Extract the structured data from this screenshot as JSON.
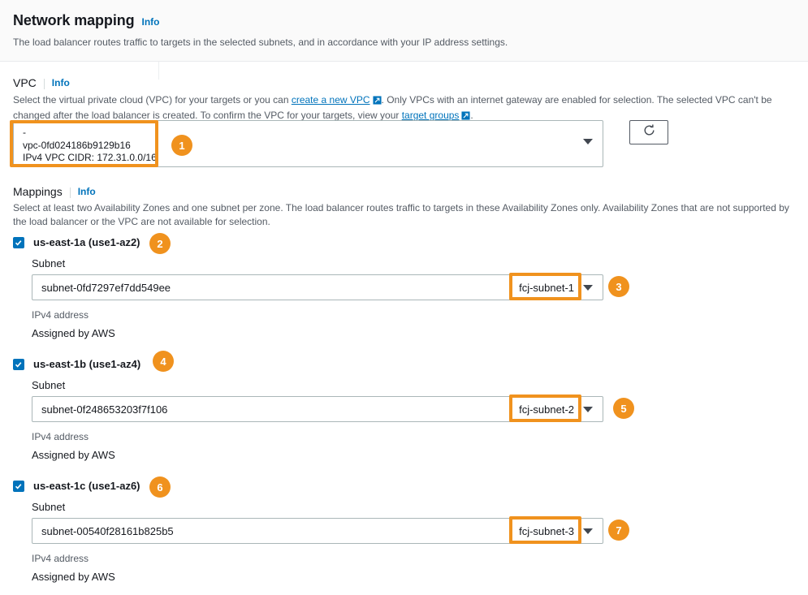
{
  "header": {
    "title": "Network mapping",
    "info_label": "Info",
    "description": "The load balancer routes traffic to targets in the selected subnets, and in accordance with your IP address settings."
  },
  "vpc": {
    "label": "VPC",
    "info_label": "Info",
    "desc_part1": "Select the virtual private cloud (VPC) for your targets or you can ",
    "desc_link1": "create a new VPC",
    "desc_part2": ". Only VPCs with an internet gateway are enabled for selection. The selected VPC can't be changed after the load balancer is created. To confirm the VPC for your targets, view your ",
    "desc_link2": "target groups",
    "desc_part3": ".",
    "selected_name": "-",
    "selected_id": "vpc-0fd024186b9129b16",
    "selected_cidr": "IPv4 VPC CIDR: 172.31.0.0/16",
    "refresh_icon": "refresh-icon",
    "caret_icon": "chevron-down-icon"
  },
  "mappings": {
    "label": "Mappings",
    "info_label": "Info",
    "description": "Select at least two Availability Zones and one subnet per zone. The load balancer routes traffic to targets in these Availability Zones only. Availability Zones that are not supported by the load balancer or the VPC are not available for selection.",
    "subnet_label": "Subnet",
    "ipv4_label": "IPv4 address",
    "ipv4_value": "Assigned by AWS",
    "zones": [
      {
        "name": "us-east-1a (use1-az2)",
        "checked": true,
        "subnet_id": "subnet-0fd7297ef7dd549ee",
        "subnet_tag": "fcj-subnet-1"
      },
      {
        "name": "us-east-1b (use1-az4)",
        "checked": true,
        "subnet_id": "subnet-0f248653203f7f106",
        "subnet_tag": "fcj-subnet-2"
      },
      {
        "name": "us-east-1c (use1-az6)",
        "checked": true,
        "subnet_id": "subnet-00540f28161b825b5",
        "subnet_tag": "fcj-subnet-3"
      }
    ]
  },
  "annotations": {
    "accent_color": "#f0921e",
    "badges": [
      {
        "number": "1"
      },
      {
        "number": "2"
      },
      {
        "number": "3"
      },
      {
        "number": "4"
      },
      {
        "number": "5"
      },
      {
        "number": "6"
      },
      {
        "number": "7"
      }
    ]
  },
  "colors": {
    "link": "#0073bb",
    "text": "#16191f",
    "muted": "#545b64",
    "border": "#aab7b8",
    "header_bg": "#fafafa"
  }
}
